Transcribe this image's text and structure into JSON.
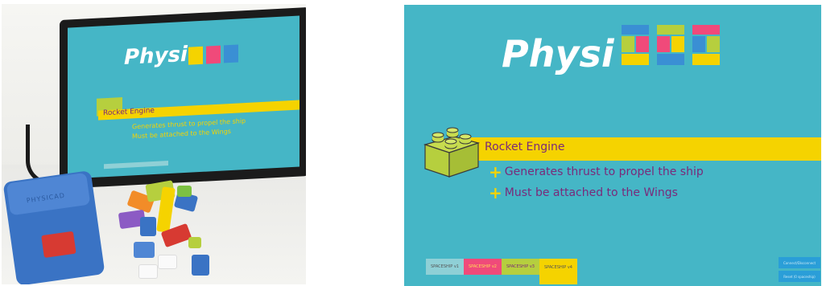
{
  "photo": {
    "device_label": "PHYSICAD",
    "tablet_screen": {
      "title": "Physi",
      "heading": "Rocket Engine",
      "bullets": [
        "Generates thrust to propel the ship",
        "Must be attached to the Wings"
      ]
    }
  },
  "screen": {
    "logo_text": "Physi",
    "component_title": "Rocket Engine",
    "bullets": [
      {
        "text": "Generates thrust to propel the ship"
      },
      {
        "text": "Must be attached to the Wings"
      }
    ],
    "tabs": [
      {
        "label": "SPACESHIP v1",
        "bg": "#8fd0d6",
        "color": "#555555"
      },
      {
        "label": "SPACESHIP v2",
        "bg": "#f04a7a",
        "color": "#ffdd55"
      },
      {
        "label": "SPACESHIP v3",
        "bg": "#b6cf3e",
        "color": "#7a2a7a"
      },
      {
        "label": "SPACESHIP v4",
        "bg": "#f5d300",
        "color": "#555555"
      }
    ],
    "corner_buttons": [
      "Connect/Disconnect",
      "Reset (0 spaceship)"
    ]
  },
  "colors": {
    "screen_bg": "#45b6c6",
    "band_yellow": "#f5d300",
    "text_purple": "#7a2a7a",
    "lego_green": "#b6cf3e",
    "device_blue": "#3a73c4"
  }
}
